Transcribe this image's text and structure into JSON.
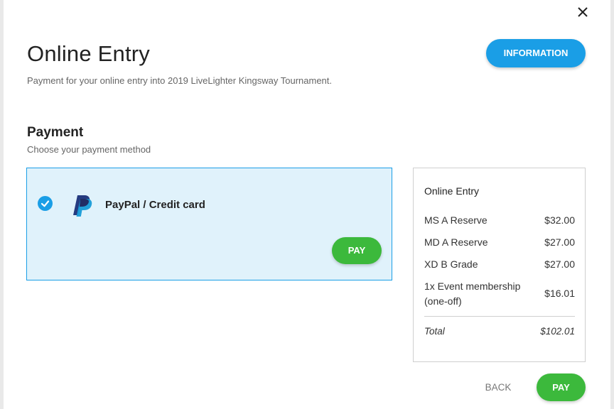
{
  "dialog": {
    "close_icon": "close-icon",
    "title": "Online Entry",
    "subtitle": "Payment for your online entry into 2019 LiveLighter Kingsway Tournament.",
    "info_button_label": "INFORMATION"
  },
  "payment": {
    "heading": "Payment",
    "subheading": "Choose your payment method",
    "methods": [
      {
        "label": "PayPal / Credit card",
        "selected": true,
        "icon": "paypal-icon",
        "pay_label": "PAY"
      }
    ]
  },
  "summary": {
    "title": "Online Entry",
    "items": [
      {
        "name": "MS A Reserve",
        "price": "$32.00"
      },
      {
        "name": "MD A Reserve",
        "price": "$27.00"
      },
      {
        "name": "XD B Grade",
        "price": "$27.00"
      },
      {
        "name": "1x Event membership (one-off)",
        "price": "$16.01"
      }
    ],
    "total_label": "Total",
    "total_value": "$102.01"
  },
  "footer": {
    "back_label": "BACK",
    "pay_label": "PAY"
  },
  "colors": {
    "accent_blue": "#1a9ee6",
    "selected_bg": "#e0f2fb",
    "pay_green": "#3cb93c"
  }
}
